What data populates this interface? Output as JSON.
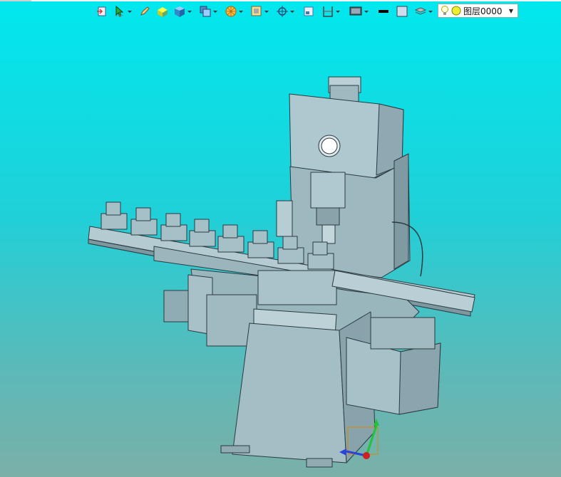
{
  "toolbar": {
    "items": [
      {
        "icon": "open-file-icon",
        "dropdown": false
      },
      {
        "icon": "pointer-dropdown-icon",
        "dropdown": true
      },
      {
        "icon": "pencil-icon",
        "dropdown": false
      },
      {
        "icon": "cube-yellow-icon",
        "dropdown": false
      },
      {
        "icon": "cube-blue-icon",
        "dropdown": true
      },
      {
        "icon": "view-cube-icon",
        "dropdown": true
      },
      {
        "icon": "render-sphere-icon",
        "dropdown": true
      },
      {
        "icon": "material-box-icon",
        "dropdown": true
      },
      {
        "icon": "crosshair-icon",
        "dropdown": true
      },
      {
        "icon": "zoom-window-icon",
        "dropdown": false
      },
      {
        "icon": "section-plane-icon",
        "dropdown": true
      },
      {
        "icon": "display-mode-icon",
        "dropdown": true
      },
      {
        "icon": "line-color-icon",
        "dropdown": false
      },
      {
        "icon": "fill-color-icon",
        "dropdown": false
      },
      {
        "icon": "layers-stack-icon",
        "dropdown": true
      }
    ],
    "layer": {
      "name": "图层0000"
    }
  },
  "viewport": {
    "background_top": "#00e8ee",
    "background_bottom": "#7ab0a8",
    "model_color": "#a9c3ca",
    "triad": {
      "x": "red",
      "y": "green",
      "z": "blue"
    }
  }
}
